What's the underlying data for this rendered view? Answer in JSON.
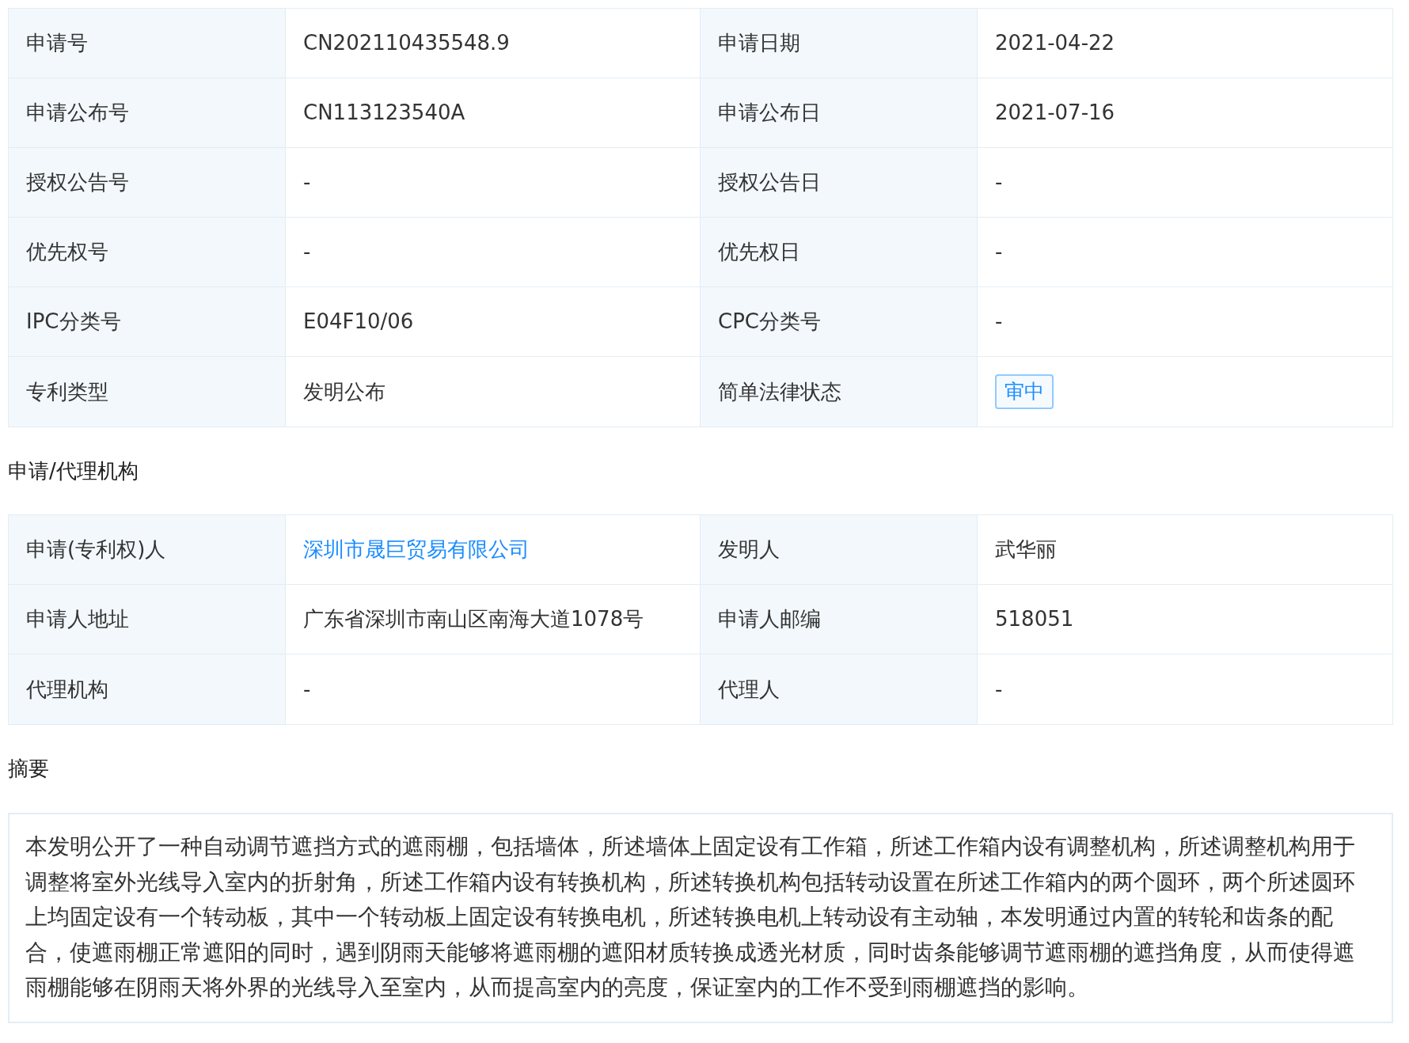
{
  "basic_info": {
    "rows": [
      [
        {
          "label": "申请号",
          "value": "CN202110435548.9",
          "kind": "text"
        },
        {
          "label": "申请日期",
          "value": "2021-04-22",
          "kind": "text"
        }
      ],
      [
        {
          "label": "申请公布号",
          "value": "CN113123540A",
          "kind": "text"
        },
        {
          "label": "申请公布日",
          "value": "2021-07-16",
          "kind": "text"
        }
      ],
      [
        {
          "label": "授权公告号",
          "value": "-",
          "kind": "text"
        },
        {
          "label": "授权公告日",
          "value": "-",
          "kind": "text"
        }
      ],
      [
        {
          "label": "优先权号",
          "value": "-",
          "kind": "text"
        },
        {
          "label": "优先权日",
          "value": "-",
          "kind": "text"
        }
      ],
      [
        {
          "label": "IPC分类号",
          "value": "E04F10/06",
          "kind": "text"
        },
        {
          "label": "CPC分类号",
          "value": "-",
          "kind": "text"
        }
      ],
      [
        {
          "label": "专利类型",
          "value": "发明公布",
          "kind": "text"
        },
        {
          "label": "简单法律状态",
          "value": "审中",
          "kind": "tag"
        }
      ]
    ]
  },
  "agency": {
    "title": "申请/代理机构",
    "rows": [
      [
        {
          "label": "申请(专利权)人",
          "value": "深圳市晟巨贸易有限公司",
          "kind": "link"
        },
        {
          "label": "发明人",
          "value": "武华丽",
          "kind": "text"
        }
      ],
      [
        {
          "label": "申请人地址",
          "value": "广东省深圳市南山区南海大道1078号",
          "kind": "text"
        },
        {
          "label": "申请人邮编",
          "value": "518051",
          "kind": "text"
        }
      ],
      [
        {
          "label": "代理机构",
          "value": "-",
          "kind": "text"
        },
        {
          "label": "代理人",
          "value": "-",
          "kind": "text"
        }
      ]
    ]
  },
  "abstract": {
    "title": "摘要",
    "text": "本发明公开了一种自动调节遮挡方式的遮雨棚，包括墙体，所述墙体上固定设有工作箱，所述工作箱内设有调整机构，所述调整机构用于调整将室外光线导入室内的折射角，所述工作箱内设有转换机构，所述转换机构包括转动设置在所述工作箱内的两个圆环，两个所述圆环上均固定设有一个转动板，其中一个转动板上固定设有转换电机，所述转换电机上转动设有主动轴，本发明通过内置的转轮和齿条的配合，使遮雨棚正常遮阳的同时，遇到阴雨天能够将遮雨棚的遮阳材质转换成透光材质，同时齿条能够调节遮雨棚的遮挡角度，从而使得遮雨棚能够在阴雨天将外界的光线导入至室内，从而提高室内的亮度，保证室内的工作不受到雨棚遮挡的影响。"
  }
}
